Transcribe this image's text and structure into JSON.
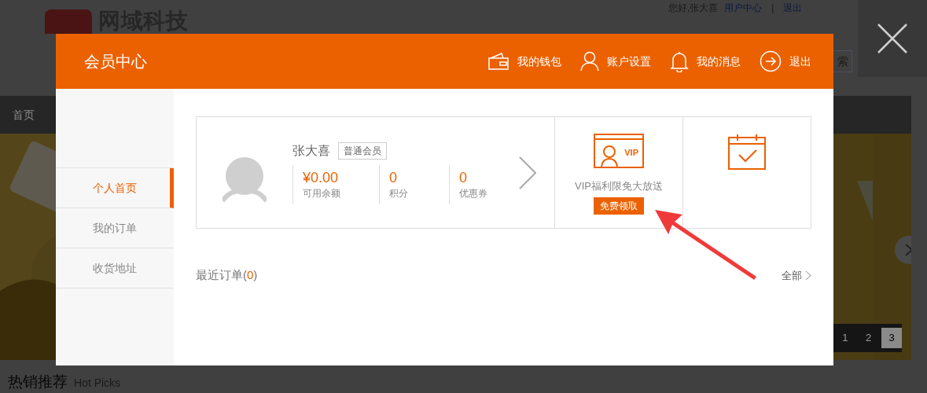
{
  "background_page": {
    "logo_text": "网域科技",
    "greeting": "您好,张大喜",
    "user_center_link": "用户中心",
    "separator": "|",
    "logout_link": "退出",
    "search_button": "索",
    "nav": [
      {
        "label": "首页"
      }
    ],
    "banner": {
      "kind": "picture",
      "pager": [
        {
          "label": "1",
          "selected": false
        },
        {
          "label": "2",
          "selected": false
        },
        {
          "label": "3",
          "selected": true
        }
      ]
    },
    "section_title": "热销推荐",
    "section_subtitle": "Hot Picks"
  },
  "modal": {
    "title": "会员中心",
    "header_links": [
      {
        "kind": "wallet",
        "label": "我的钱包"
      },
      {
        "kind": "user",
        "label": "账户设置"
      },
      {
        "kind": "bell",
        "label": "我的消息"
      },
      {
        "kind": "exit",
        "label": "退出"
      }
    ],
    "sidebar": [
      {
        "label": "个人首页",
        "selected": true
      },
      {
        "label": "我的订单",
        "selected": false
      },
      {
        "label": "收货地址",
        "selected": false
      }
    ],
    "profile": {
      "name": "张大喜",
      "badge": "普通会员",
      "stats": [
        {
          "value": "¥0.00",
          "label": "可用余额"
        },
        {
          "value": "0",
          "label": "积分"
        },
        {
          "value": "0",
          "label": "优惠券"
        }
      ]
    },
    "vip": {
      "icon_text": "VIP",
      "text": "VIP福利限免大放送",
      "button": "免费领取"
    },
    "recent_orders": {
      "title_before": "最近订单(",
      "count": "0",
      "title_after": ")",
      "all_link": "全部"
    }
  }
}
